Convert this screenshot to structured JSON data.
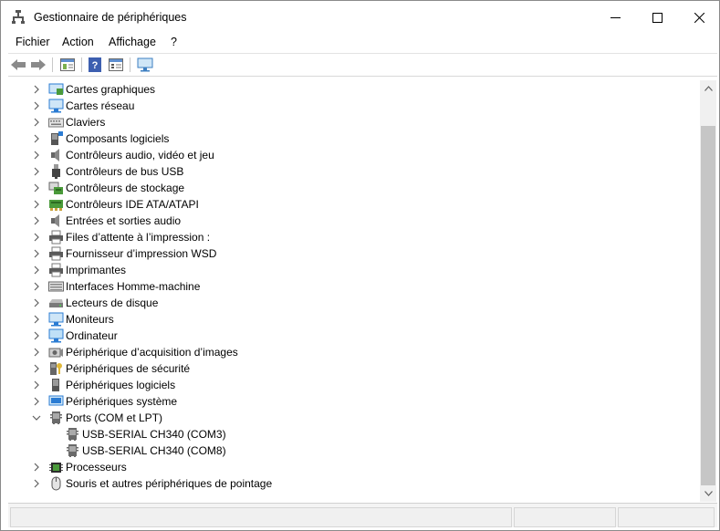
{
  "window": {
    "title": "Gestionnaire de périphériques",
    "controls": {
      "minimize_icon": "minimize-icon",
      "maximize_icon": "maximize-icon",
      "close_icon": "close-icon"
    }
  },
  "menu": [
    "Fichier",
    "Action",
    "Affichage",
    "?"
  ],
  "toolbar": {
    "buttons": [
      "back-arrow-icon",
      "forward-arrow-icon",
      "properties-icon",
      "help-icon",
      "details-view-icon",
      "monitor-icon"
    ]
  },
  "tree": {
    "items": [
      {
        "label": "Cartes graphiques",
        "icon": "display-adapter-icon",
        "expanded": false
      },
      {
        "label": "Cartes réseau",
        "icon": "network-adapter-icon",
        "expanded": false
      },
      {
        "label": "Claviers",
        "icon": "keyboard-icon",
        "expanded": false
      },
      {
        "label": "Composants logiciels",
        "icon": "software-component-icon",
        "expanded": false
      },
      {
        "label": "Contrôleurs audio, vidéo et jeu",
        "icon": "speaker-icon",
        "expanded": false
      },
      {
        "label": "Contrôleurs de bus USB",
        "icon": "usb-plug-icon",
        "expanded": false
      },
      {
        "label": "Contrôleurs de stockage",
        "icon": "storage-controller-icon",
        "expanded": false
      },
      {
        "label": "Contrôleurs IDE ATA/ATAPI",
        "icon": "ide-controller-icon",
        "expanded": false
      },
      {
        "label": "Entrées et sorties audio",
        "icon": "speaker-icon",
        "expanded": false
      },
      {
        "label": "Files d’attente à l’impression :",
        "icon": "printer-icon",
        "expanded": false
      },
      {
        "label": "Fournisseur d’impression WSD",
        "icon": "printer-icon",
        "expanded": false
      },
      {
        "label": "Imprimantes",
        "icon": "printer-icon",
        "expanded": false
      },
      {
        "label": "Interfaces Homme-machine",
        "icon": "hid-keyboard-icon",
        "expanded": false
      },
      {
        "label": "Lecteurs de disque",
        "icon": "disk-drive-icon",
        "expanded": false
      },
      {
        "label": "Moniteurs",
        "icon": "monitor-icon",
        "expanded": false
      },
      {
        "label": "Ordinateur",
        "icon": "computer-icon",
        "expanded": false
      },
      {
        "label": "Périphérique d’acquisition d’images",
        "icon": "camera-icon",
        "expanded": false
      },
      {
        "label": "Périphériques de sécurité",
        "icon": "security-key-icon",
        "expanded": false
      },
      {
        "label": "Périphériques logiciels",
        "icon": "software-device-icon",
        "expanded": false
      },
      {
        "label": "Périphériques système",
        "icon": "system-device-icon",
        "expanded": false
      },
      {
        "label": "Ports (COM et LPT)",
        "icon": "port-icon",
        "expanded": true
      },
      {
        "label": "USB-SERIAL CH340 (COM3)",
        "icon": "port-icon",
        "child": true
      },
      {
        "label": "USB-SERIAL CH340 (COM8)",
        "icon": "port-icon",
        "child": true
      },
      {
        "label": "Processeurs",
        "icon": "processor-icon",
        "expanded": false
      },
      {
        "label": "Souris et autres périphériques de pointage",
        "icon": "mouse-icon",
        "expanded": false
      }
    ]
  },
  "colors": {
    "accent_blue": "#2b7cd3",
    "chevron": "#606060",
    "scroll_thumb": "#c6c6c6"
  }
}
